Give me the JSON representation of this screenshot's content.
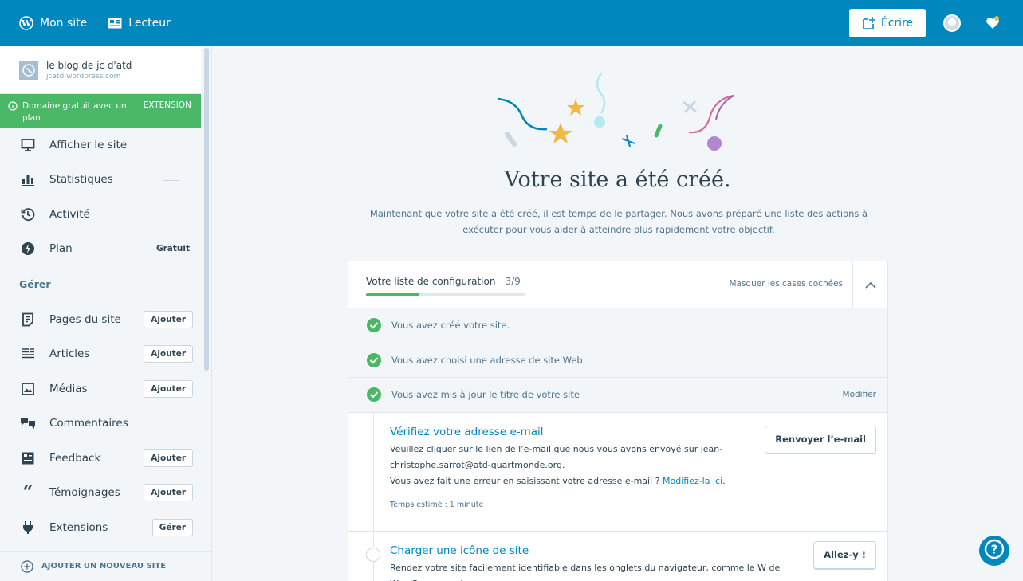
{
  "topbar": {
    "my_site": "Mon site",
    "reader": "Lecteur",
    "write": "Écrire"
  },
  "colors": {
    "brand": "#0087be",
    "success": "#4ab866",
    "text": "#2e4453"
  },
  "sidebar": {
    "site_name": "le blog de jc d'atd",
    "site_url": "jcatd.wordpress.com",
    "promo_text": "Domaine gratuit avec un plan",
    "promo_cta": "EXTENSION",
    "items": [
      {
        "label": "Afficher le site",
        "icon": "monitor-icon"
      },
      {
        "label": "Statistiques",
        "icon": "stats-icon"
      },
      {
        "label": "Activité",
        "icon": "history-icon"
      },
      {
        "label": "Plan",
        "icon": "plan-icon",
        "badge": "Gratuit"
      }
    ],
    "manage_heading": "Gérer",
    "manage_items": [
      {
        "label": "Pages du site",
        "icon": "pages-icon",
        "action": "Ajouter"
      },
      {
        "label": "Articles",
        "icon": "posts-icon",
        "action": "Ajouter"
      },
      {
        "label": "Médias",
        "icon": "media-icon",
        "action": "Ajouter"
      },
      {
        "label": "Commentaires",
        "icon": "comments-icon"
      },
      {
        "label": "Feedback",
        "icon": "feedback-icon",
        "action": "Ajouter"
      },
      {
        "label": "Témoignages",
        "icon": "quote-icon",
        "action": "Ajouter"
      },
      {
        "label": "Extensions",
        "icon": "plugin-icon",
        "action": "Gérer"
      }
    ],
    "add_site": "AJOUTER UN NOUVEAU SITE"
  },
  "main": {
    "title": "Votre site a été créé.",
    "subtitle": "Maintenant que votre site a été créé, il est temps de le partager. Nous avons préparé une liste des actions à exécuter pour vous aider à atteindre plus rapidement votre objectif.",
    "checklist": {
      "title": "Votre liste de configuration",
      "count": "3/9",
      "progress": 0.3333,
      "hide_checked": "Masquer les cases cochées",
      "done_tasks": [
        {
          "label": "Vous avez créé votre site."
        },
        {
          "label": "Vous avez choisi une adresse de site Web"
        },
        {
          "label": "Vous avez mis à jour le titre de votre site",
          "edit": "Modifier"
        }
      ],
      "active_task": {
        "title": "Vérifiez votre adresse e-mail",
        "desc1": "Veuillez cliquer sur le lien de l’e-mail que nous vous avons envoyé sur jean-christophe.sarrot@atd-quartmonde.org.",
        "desc2": "Vous avez fait une erreur en saisissant votre adresse e-mail ? ",
        "desc2_link": "Modifiez-la ici",
        "desc2_end": ".",
        "time": "Temps estimé : 1 minute",
        "button": "Renvoyer l’e-mail"
      },
      "next_task": {
        "title": "Charger une icône de site",
        "desc": "Rendez votre site facilement identifiable dans les onglets du navigateur, comme le W de WordPress.com !",
        "button": "Allez-y !"
      }
    }
  }
}
